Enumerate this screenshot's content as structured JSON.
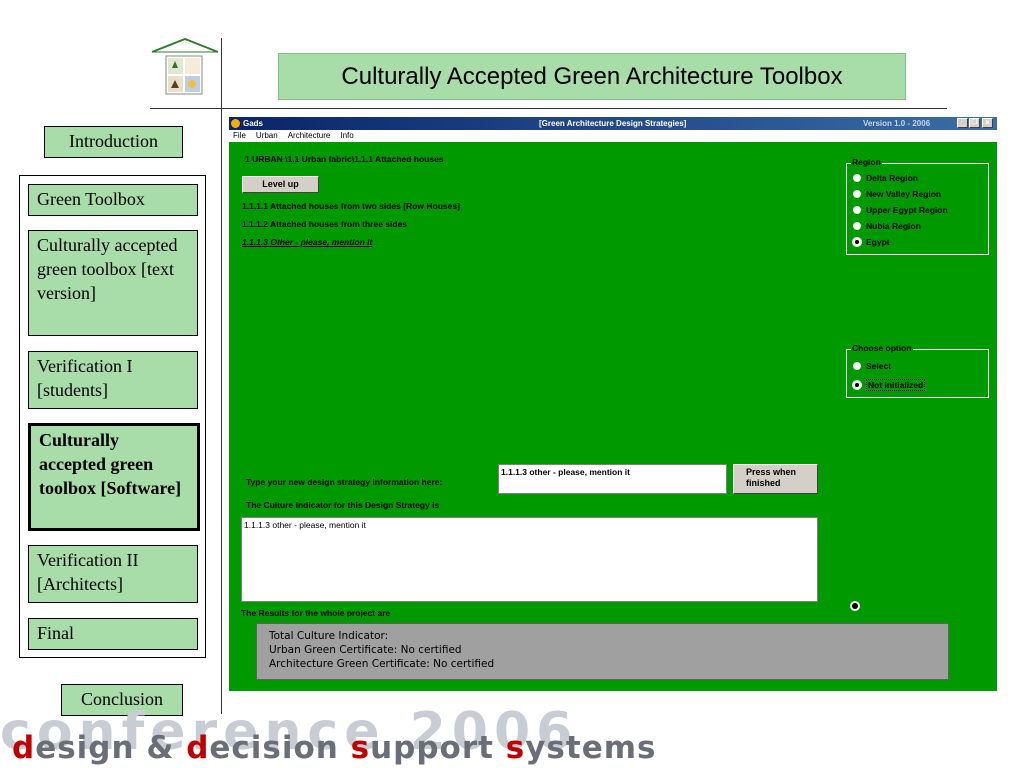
{
  "slide": {
    "title": "Culturally Accepted Green Architecture Toolbox",
    "footer_big": "conference 2006",
    "footer_small": [
      "d",
      "esign & ",
      "d",
      "ecision ",
      "s",
      "upport ",
      "s",
      "ystems"
    ]
  },
  "nav": {
    "introduction": "Introduction",
    "items": [
      {
        "label": "Green Toolbox"
      },
      {
        "label": "Culturally accepted green toolbox [text version]"
      },
      {
        "label": "Verification I [students]"
      },
      {
        "label": "Culturally accepted green toolbox [Software]"
      },
      {
        "label": "Verification II [Architects]"
      },
      {
        "label": "Final"
      }
    ],
    "conclusion": "Conclusion"
  },
  "window": {
    "title": "Gads",
    "subtitle": "[Green Architecture Design Strategies]",
    "version": "Version 1.0 - 2006",
    "menu": [
      "File",
      "Urban",
      "Architecture",
      "Info"
    ],
    "path": "1 URBAN \\1.1   Urban fabric\\1.1.1 Attached houses",
    "level_up": "Level up",
    "options": [
      "1.1.1.1 Attached houses from two sides [Row Houses]",
      "1.1.1.2 Attached houses from three sides",
      "1.1.1.3 Other - please, mention it"
    ],
    "region": {
      "legend": "Region",
      "items": [
        "Delta Region",
        "New Valley Region",
        "Upper Egypt Region",
        "Nubia Region",
        "Egypt"
      ],
      "selected": "Egypt"
    },
    "choose": {
      "legend": "Choose option",
      "items": [
        "Select",
        "Not initialized"
      ],
      "selected": "Not initialized"
    },
    "type_label": "Type your new design strategy information here:",
    "strategy_value": "1.1.1.3 other - please, mention it",
    "press_button": "Press when finished",
    "culture_label": "The Culture Indicator for this Design Strategy is",
    "culture_text": "1.1.1.3 other - please, mention it",
    "results_label": "The Results for the whole project are",
    "results": {
      "line1": "Total Culture Indicator:",
      "line2": "Urban Green Certificate: No certified",
      "line3": "Architecture Green Certificate: No certified"
    }
  },
  "colors": {
    "nav_green": "#a8dca8",
    "app_green": "#009900",
    "title_blue": "#0a246a"
  }
}
